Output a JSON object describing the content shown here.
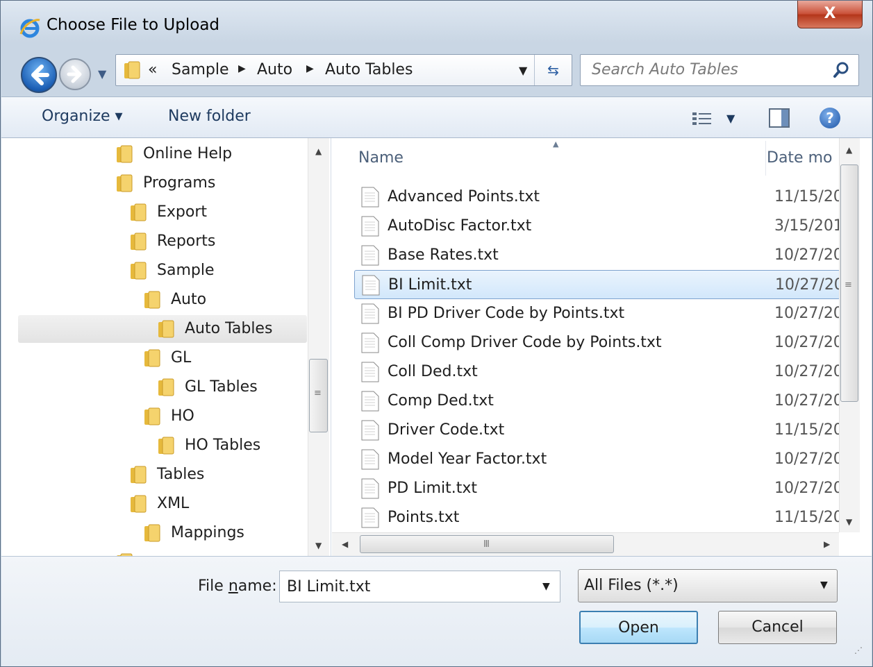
{
  "window": {
    "title": "Choose File to Upload",
    "close_label": "X"
  },
  "navigation": {
    "breadcrumb_overflow": "«",
    "breadcrumb": [
      "Sample",
      "Auto",
      "Auto Tables"
    ],
    "search_placeholder": "Search Auto Tables"
  },
  "toolbar": {
    "organize_label": "Organize ▾",
    "new_folder_label": "New folder"
  },
  "tree": {
    "items": [
      {
        "label": "Online Help"
      },
      {
        "label": "Programs"
      },
      {
        "label": "Export"
      },
      {
        "label": "Reports"
      },
      {
        "label": "Sample"
      },
      {
        "label": "Auto"
      },
      {
        "label": "Auto Tables"
      },
      {
        "label": "GL"
      },
      {
        "label": "GL Tables"
      },
      {
        "label": "HO"
      },
      {
        "label": "HO Tables"
      },
      {
        "label": "Tables"
      },
      {
        "label": "XML"
      },
      {
        "label": "Mappings"
      }
    ],
    "selected": "Auto Tables"
  },
  "file_list": {
    "columns": {
      "name": "Name",
      "date": "Date mo"
    },
    "files": [
      {
        "name": "Advanced Points.txt",
        "date": "11/15/20"
      },
      {
        "name": "AutoDisc Factor.txt",
        "date": "3/15/201"
      },
      {
        "name": "Base Rates.txt",
        "date": "10/27/20"
      },
      {
        "name": "BI Limit.txt",
        "date": "10/27/20"
      },
      {
        "name": "BI PD Driver Code by Points.txt",
        "date": "10/27/20"
      },
      {
        "name": "Coll Comp Driver Code by Points.txt",
        "date": "10/27/20"
      },
      {
        "name": "Coll Ded.txt",
        "date": "10/27/20"
      },
      {
        "name": "Comp Ded.txt",
        "date": "10/27/20"
      },
      {
        "name": "Driver Code.txt",
        "date": "11/15/20"
      },
      {
        "name": "Model Year Factor.txt",
        "date": "10/27/20"
      },
      {
        "name": "PD Limit.txt",
        "date": "10/27/20"
      },
      {
        "name": "Points.txt",
        "date": "11/15/20"
      }
    ],
    "selected": "BI Limit.txt"
  },
  "footer": {
    "file_name_label_pre": "File ",
    "file_name_label_accel": "n",
    "file_name_label_post": "ame:",
    "file_name_value": "BI Limit.txt",
    "filter_value": "All Files (*.*)",
    "open_label": "Open",
    "cancel_label": "Cancel"
  },
  "colors": {
    "selection_fill": "#d2e7fb",
    "selection_border": "#7da2ce",
    "toolbar_text": "#1e3a5f",
    "close_button": "#c94e35"
  }
}
